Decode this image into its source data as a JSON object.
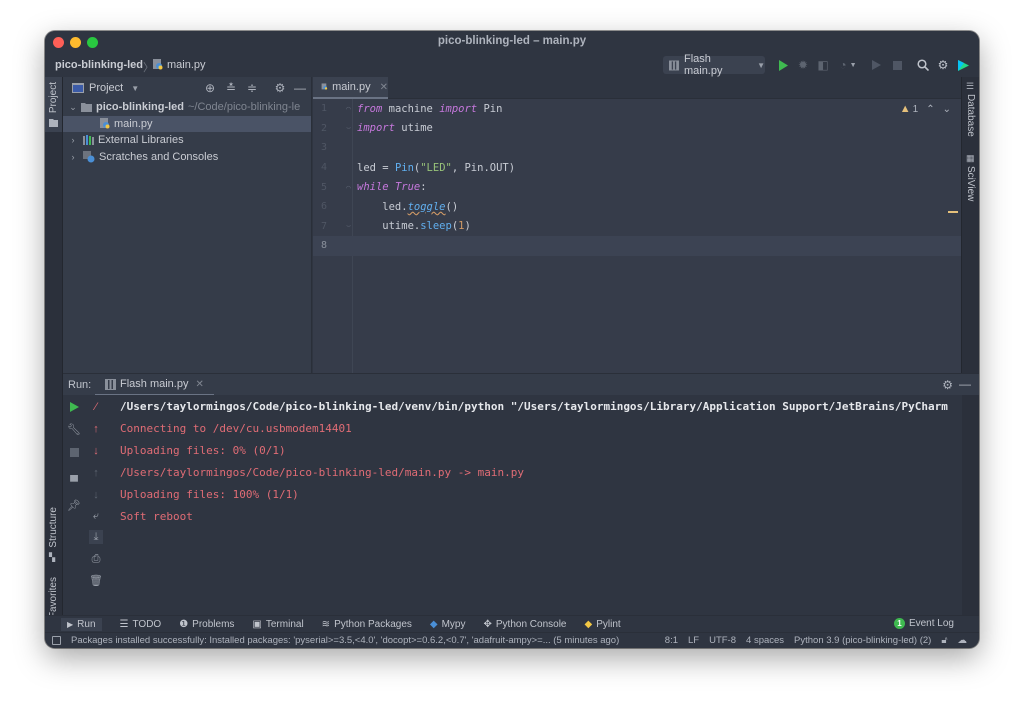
{
  "window": {
    "title": "pico-blinking-led – main.py"
  },
  "navbar": {
    "project": "pico-blinking-led",
    "separator": "〉",
    "file": "main.py",
    "run_config": "Flash main.py",
    "icons": [
      "run-icon",
      "debug-icon",
      "coverage-icon",
      "profile-icon",
      "build-icon",
      "stop-icon",
      "search-icon",
      "settings-icon",
      "jetbrains-toolbox-icon"
    ]
  },
  "left_strip": {
    "tabs": [
      "Project",
      "Structure",
      "Favorites"
    ]
  },
  "right_strip": {
    "tabs": [
      "Database",
      "SciView"
    ]
  },
  "project_panel": {
    "title": "Project",
    "tree": [
      {
        "label": "pico-blinking-led",
        "hint": "~/Code/pico-blinking-le",
        "expanded": true,
        "bold": true
      },
      {
        "label": "main.py",
        "selected": true
      },
      {
        "label": "External Libraries",
        "expanded": false
      },
      {
        "label": "Scratches and Consoles",
        "expanded": false
      }
    ]
  },
  "editor": {
    "tab": "main.py",
    "warnings_count": "1",
    "current_line": 8,
    "lines": [
      {
        "n": "1"
      },
      {
        "n": "2"
      },
      {
        "n": "3"
      },
      {
        "n": "4"
      },
      {
        "n": "5"
      },
      {
        "n": "6"
      },
      {
        "n": "7"
      },
      {
        "n": "8"
      }
    ],
    "code": {
      "l1_kw1": "from",
      "l1_mod": " machine ",
      "l1_kw2": "import",
      "l1_name": " Pin",
      "l2_kw": "import",
      "l2_mod": " utime",
      "l4_a": "led = ",
      "l4_fn": "Pin",
      "l4_b": "(",
      "l4_str": "\"LED\"",
      "l4_c": ", Pin.OUT)",
      "l5_kw": "while",
      "l5_sp": " ",
      "l5_true": "True",
      "l5_colon": ":",
      "l6_a": "    led.",
      "l6_fn": "toggle",
      "l6_b": "()",
      "l7_a": "    utime.",
      "l7_fn": "sleep",
      "l7_b": "(",
      "l7_num": "1",
      "l7_c": ")"
    }
  },
  "run_panel": {
    "label": "Run:",
    "tab": "Flash main.py",
    "console": [
      {
        "text": "/Users/taylormingos/Code/pico-blinking-led/venv/bin/python \"/Users/taylormingos/Library/Application Support/JetBrains/PyCharm",
        "type": "cmd"
      },
      {
        "text": "Connecting to /dev/cu.usbmodem14401",
        "type": "err"
      },
      {
        "text": "Uploading files: 0% (0/1)",
        "type": "err"
      },
      {
        "text": "/Users/taylormingos/Code/pico-blinking-led/main.py -> main.py",
        "type": "err"
      },
      {
        "text": "Uploading files: 100% (1/1)",
        "type": "err"
      },
      {
        "text": "Soft reboot",
        "type": "err"
      }
    ]
  },
  "tool_strip": {
    "items": [
      "Run",
      "TODO",
      "Problems",
      "Terminal",
      "Python Packages",
      "Mypy",
      "Python Console",
      "Pylint"
    ],
    "event_log": "Event Log",
    "event_count": "1"
  },
  "status_bar": {
    "message": "Packages installed successfully: Installed packages: 'pyserial>=3.5,<4.0', 'docopt>=0.6.2,<0.7', 'adafruit-ampy>=... (5 minutes ago)",
    "position": "8:1",
    "line_sep": "LF",
    "encoding": "UTF-8",
    "indent": "4 spaces",
    "interpreter": "Python 3.9 (pico-blinking-led) (2)"
  },
  "colors": {
    "accent_run": "#3fb950",
    "error_text": "#e06c75",
    "keyword": "#c678dd",
    "function": "#61afef",
    "string": "#98c379",
    "warning": "#e5c07b"
  }
}
